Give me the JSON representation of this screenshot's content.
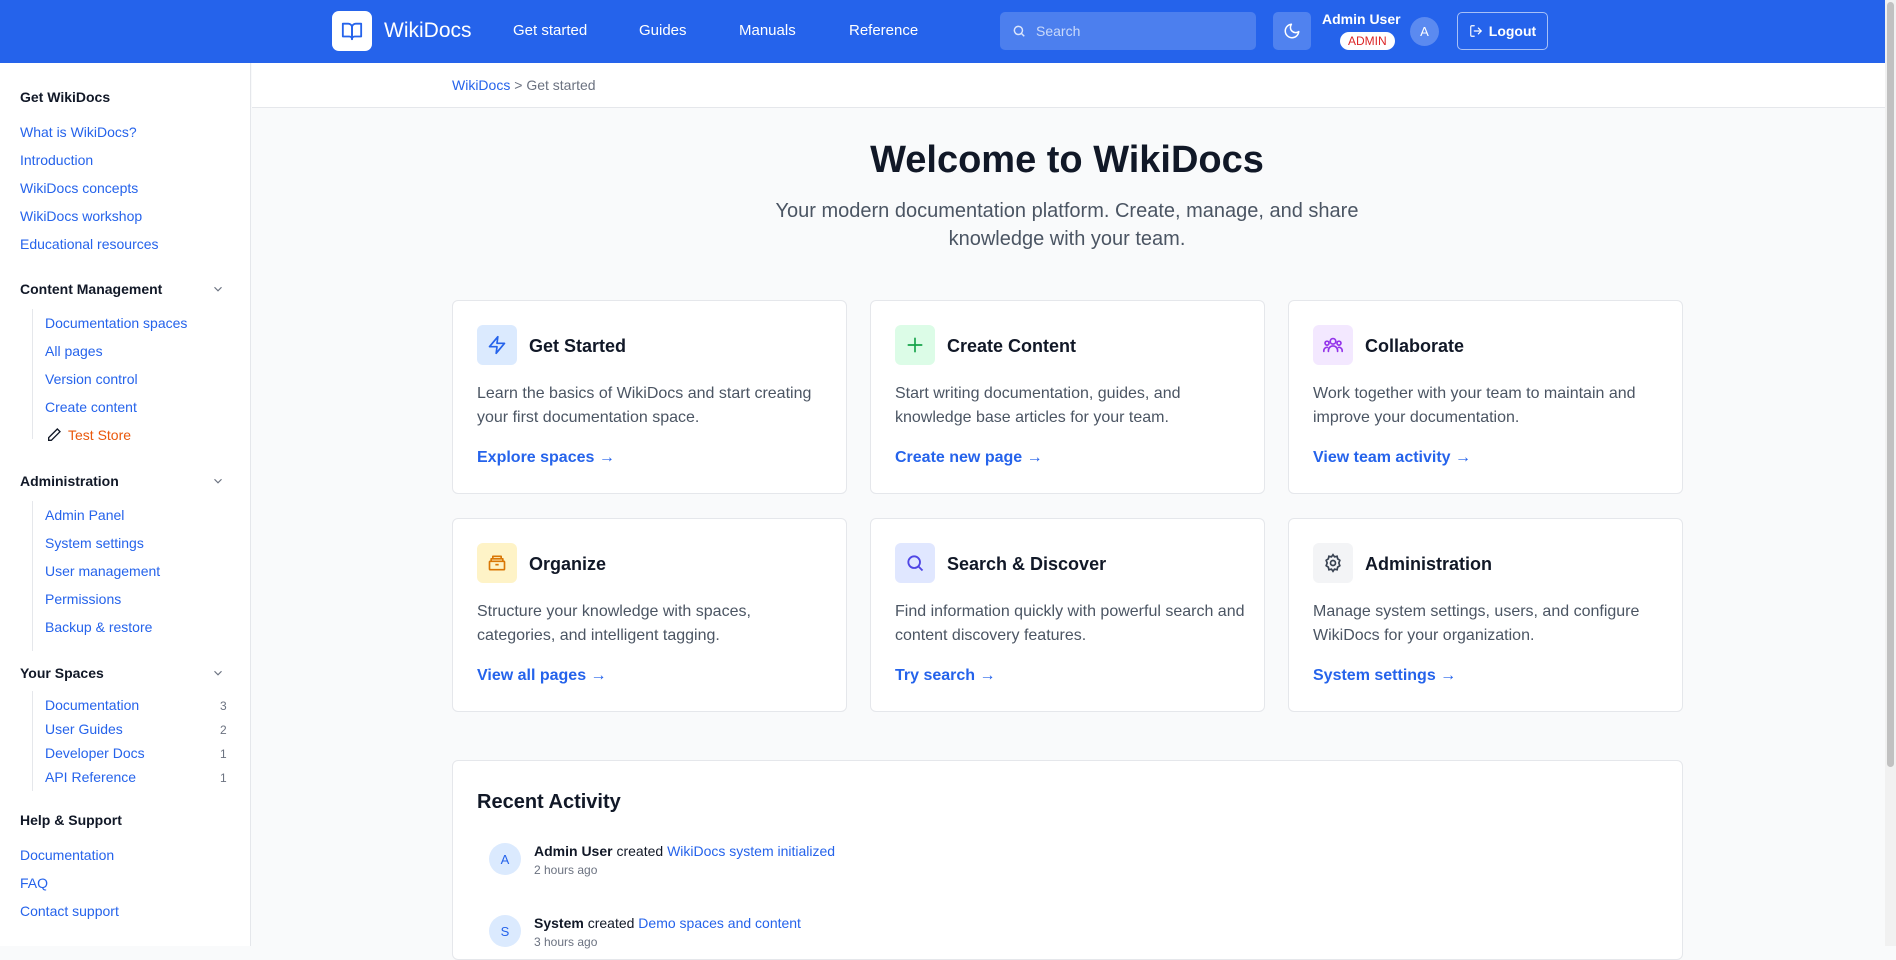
{
  "header": {
    "brand": "WikiDocs",
    "nav": [
      "Get started",
      "Guides",
      "Manuals",
      "Reference"
    ],
    "search_placeholder": "Search",
    "user_name": "Admin User",
    "user_role": "ADMIN",
    "avatar_initial": "A",
    "logout_label": "Logout"
  },
  "sidebar": {
    "get_wikidocs": {
      "title": "Get WikiDocs",
      "items": [
        "What is WikiDocs?",
        "Introduction",
        "WikiDocs concepts",
        "WikiDocs workshop",
        "Educational resources"
      ]
    },
    "content_management": {
      "title": "Content Management",
      "items": [
        "Documentation spaces",
        "All pages",
        "Version control",
        "Create content"
      ],
      "test_store": "Test Store"
    },
    "administration": {
      "title": "Administration",
      "items": [
        "Admin Panel",
        "System settings",
        "User management",
        "Permissions",
        "Backup & restore"
      ]
    },
    "your_spaces": {
      "title": "Your Spaces",
      "items": [
        {
          "label": "Documentation",
          "count": "3"
        },
        {
          "label": "User Guides",
          "count": "2"
        },
        {
          "label": "Developer Docs",
          "count": "1"
        },
        {
          "label": "API Reference",
          "count": "1"
        }
      ]
    },
    "help": {
      "title": "Help & Support",
      "items": [
        "Documentation",
        "FAQ",
        "Contact support"
      ]
    }
  },
  "breadcrumb": {
    "root": "WikiDocs",
    "separator": ">",
    "current": "Get started"
  },
  "hero": {
    "title": "Welcome to WikiDocs",
    "subtitle": "Your modern documentation platform. Create, manage, and share knowledge with your team."
  },
  "cards": [
    {
      "title": "Get Started",
      "desc": "Learn the basics of WikiDocs and start creating your first documentation space.",
      "link": "Explore spaces →",
      "icon": "lightning-icon"
    },
    {
      "title": "Create Content",
      "desc": "Start writing documentation, guides, and knowledge base articles for your team.",
      "link": "Create new page →",
      "icon": "plus-icon"
    },
    {
      "title": "Collaborate",
      "desc": "Work together with your team to maintain and improve your documentation.",
      "link": "View team activity →",
      "icon": "users-icon"
    },
    {
      "title": "Organize",
      "desc": "Structure your knowledge with spaces, categories, and intelligent tagging.",
      "link": "View all pages →",
      "icon": "archive-icon"
    },
    {
      "title": "Search & Discover",
      "desc": "Find information quickly with powerful search and content discovery features.",
      "link": "Try search →",
      "icon": "search-icon"
    },
    {
      "title": "Administration",
      "desc": "Manage system settings, users, and configure WikiDocs for your organization.",
      "link": "System settings →",
      "icon": "gear-icon"
    }
  ],
  "activity": {
    "title": "Recent Activity",
    "items": [
      {
        "avatar": "A",
        "user": "Admin User",
        "action": "created",
        "target": "WikiDocs system initialized",
        "time": "2 hours ago"
      },
      {
        "avatar": "S",
        "user": "System",
        "action": "created",
        "target": "Demo spaces and content",
        "time": "3 hours ago"
      }
    ]
  },
  "colors": {
    "primary": "#2563eb",
    "accent_orange": "#ea580c",
    "admin_badge": "#dc2626"
  }
}
